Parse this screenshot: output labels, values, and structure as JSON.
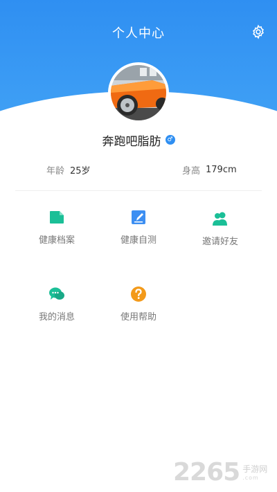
{
  "header": {
    "title": "个人中心",
    "settings_icon": "gear-icon",
    "bg_color": "#2f8ff2"
  },
  "profile": {
    "username": "奔跑吧脂肪",
    "gender_symbol": "♂",
    "age_label": "年龄",
    "age_value": "25岁",
    "height_label": "身高",
    "height_value": "179cm"
  },
  "menu": {
    "items": [
      {
        "label": "健康档案",
        "icon": "folder-icon",
        "color": "#1bbf97"
      },
      {
        "label": "健康自测",
        "icon": "edit-icon",
        "color": "#3d8ff2"
      },
      {
        "label": "邀请好友",
        "icon": "friends-icon",
        "color": "#1bbf97"
      },
      {
        "label": "我的消息",
        "icon": "chat-icon",
        "color": "#1bbf97"
      },
      {
        "label": "使用帮助",
        "icon": "help-icon",
        "color": "#f39a1a"
      }
    ]
  },
  "watermark": {
    "number": "2265",
    "text": "手游网",
    "sub": ".com"
  }
}
